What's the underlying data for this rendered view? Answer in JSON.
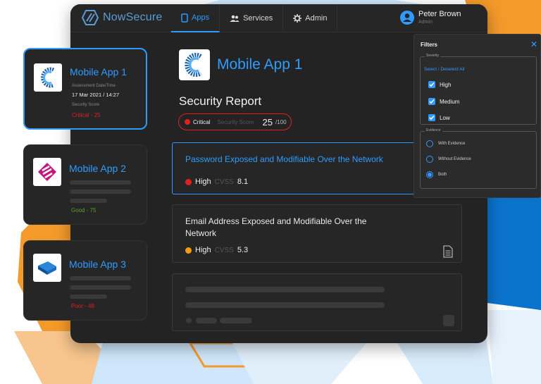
{
  "colors": {
    "accent": "#2f9bff",
    "critical": "#e02020",
    "high": "#e02020",
    "medium_high": "#f39c12",
    "good": "#5aa02c",
    "poor": "#e02020"
  },
  "brand": {
    "name": "NowSecure"
  },
  "nav": [
    {
      "label": "Apps",
      "icon": "phone-icon",
      "active": true
    },
    {
      "label": "Services",
      "icon": "users-icon",
      "active": false
    },
    {
      "label": "Admin",
      "icon": "gear-icon",
      "active": false
    }
  ],
  "user": {
    "name": "Peter Brown",
    "role": "Admin"
  },
  "app": {
    "title": "Mobile App 1"
  },
  "report": {
    "title": "Security Report",
    "severity_label": "Critical",
    "score_label": "Security Score",
    "score": "25",
    "score_max": "/100"
  },
  "findings": [
    {
      "title": "Password Exposed and Modifiable Over the Network",
      "severity": "High",
      "cvss_label": "CVSS",
      "cvss": "8.1"
    },
    {
      "title": "Email Address Exposed and Modifiable Over the Network",
      "severity": "High",
      "cvss_label": "CVSS",
      "cvss": "5.3"
    }
  ],
  "apps": [
    {
      "name": "Mobile App 1",
      "date_label": "Assessment Date/Time",
      "date": "17 Mar 2021 / 14:27",
      "score_label": "Security Score",
      "status": "Critical - 25"
    },
    {
      "name": "Mobile App 2",
      "status": "Good - 75"
    },
    {
      "name": "Mobile App 3",
      "status": "Poor - 48"
    }
  ],
  "filters": {
    "title": "Filters",
    "close": "✕",
    "severity_legend": "Severity",
    "select_all": "Select / Deselect All",
    "severity_options": [
      "High",
      "Medium",
      "Low"
    ],
    "evidence_legend": "Evidence",
    "evidence_options": [
      "With Evidence",
      "Without Evidence",
      "Both"
    ],
    "evidence_selected": "Both"
  }
}
